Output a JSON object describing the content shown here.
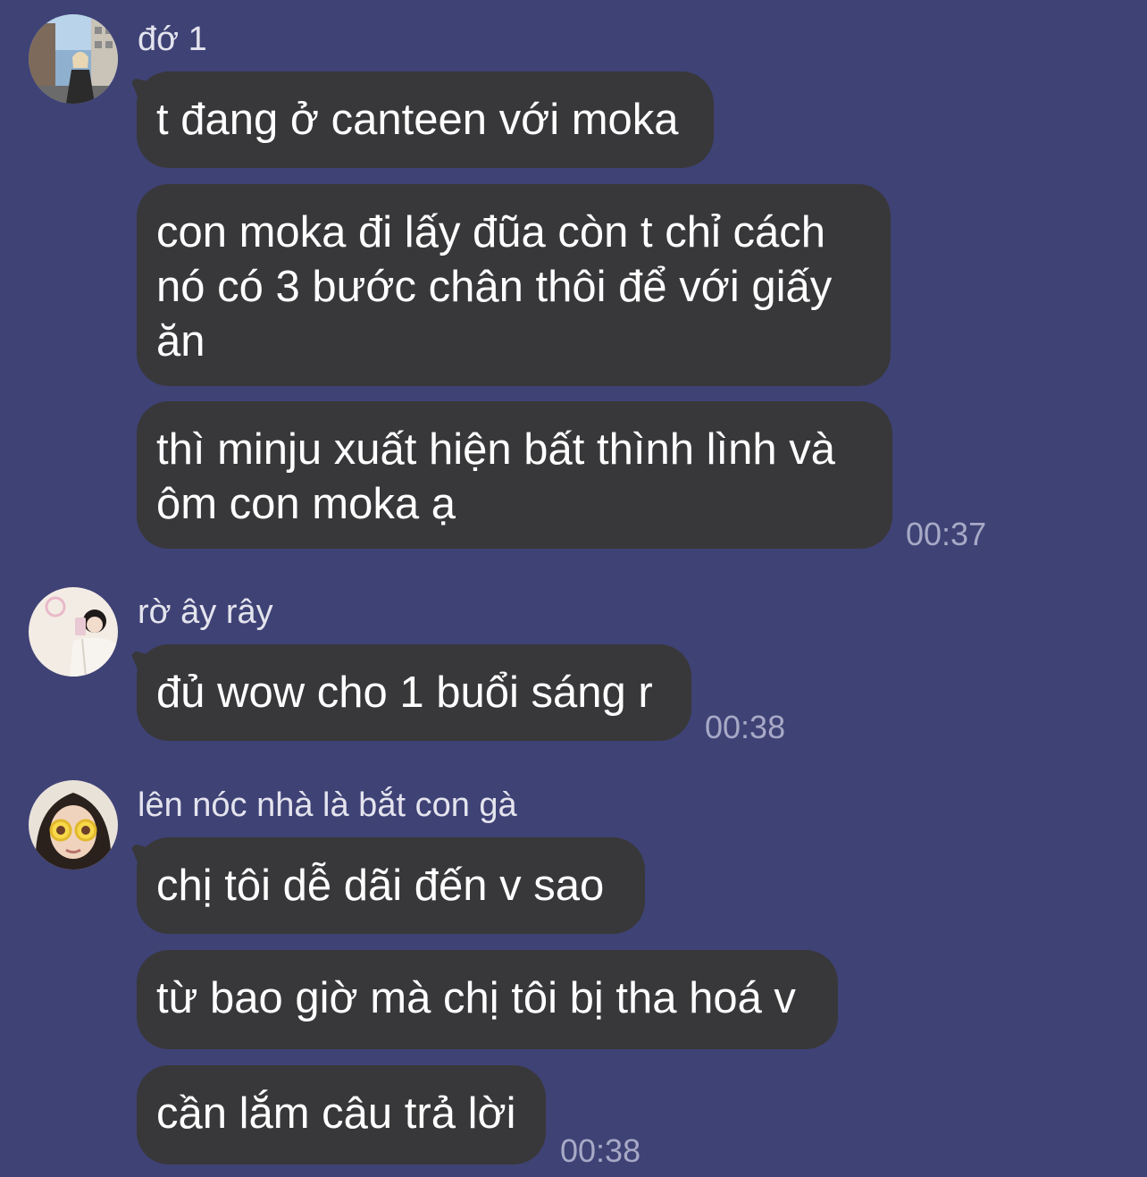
{
  "messages": [
    {
      "sender": "đớ 1",
      "avatar": "avatar-street-girl",
      "bubbles": [
        "t đang ở canteen với moka",
        "con moka đi lấy đũa còn t chỉ cách\nnó có 3 bước chân thôi để với giấy\năn",
        "thì minju xuất hiện bất thình lình và\nôm con moka ạ"
      ],
      "time": "00:37"
    },
    {
      "sender": "rờ ây rây",
      "avatar": "avatar-mirror-selfie",
      "bubbles": [
        "đủ wow cho 1 buổi sáng r"
      ],
      "time": "00:38"
    },
    {
      "sender": "lên nóc nhà là bắt con gà",
      "avatar": "avatar-kid-glasses",
      "bubbles": [
        "chị tôi dễ dãi đến v sao",
        "từ bao giờ mà chị tôi bị tha hoá v",
        "cần lắm câu trả lời"
      ],
      "time": "00:38"
    }
  ],
  "colors": {
    "background": "#3f4275",
    "bubble": "#38383a",
    "text": "#ffffff",
    "timestamp": "#a7a9c6"
  }
}
